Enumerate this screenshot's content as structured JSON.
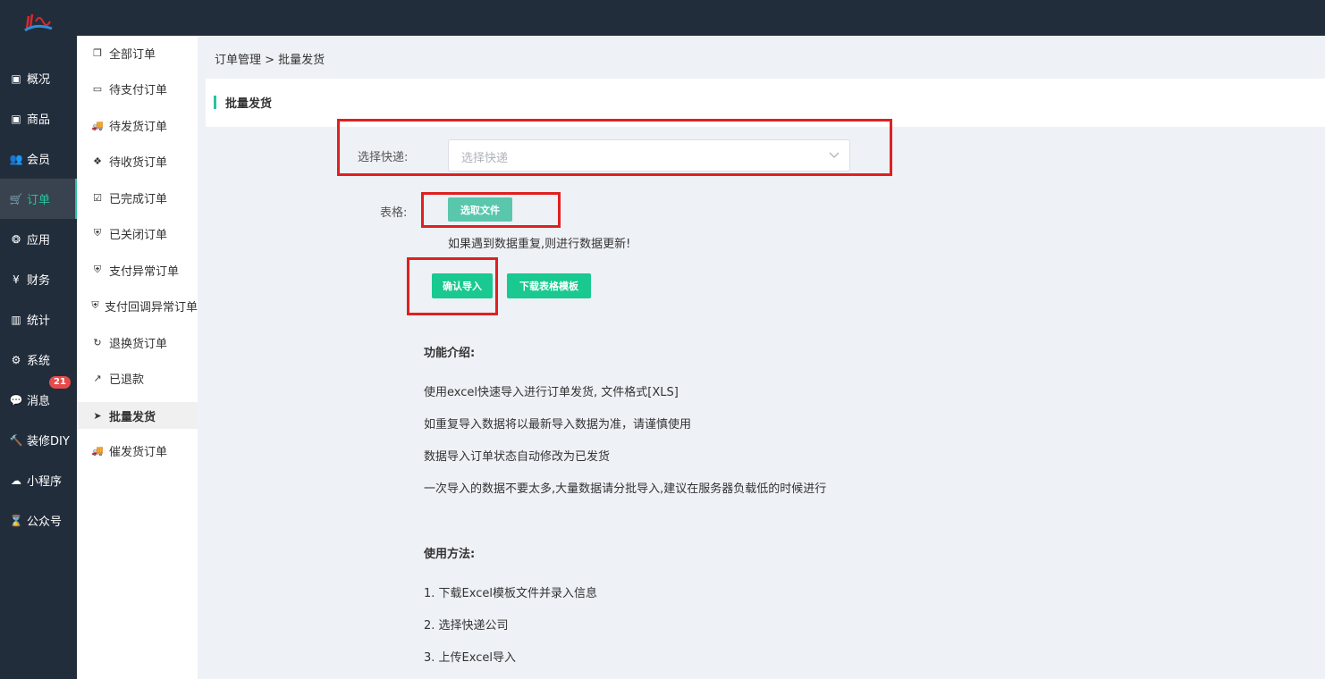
{
  "sidebar": {
    "items": [
      {
        "label": "概况",
        "icon": "dashboard-icon",
        "glyph": "▣"
      },
      {
        "label": "商品",
        "icon": "goods-icon",
        "glyph": "▣"
      },
      {
        "label": "会员",
        "icon": "users-icon",
        "glyph": "👥"
      },
      {
        "label": "订单",
        "icon": "cart-icon",
        "glyph": "🛒"
      },
      {
        "label": "应用",
        "icon": "apps-icon",
        "glyph": "❂"
      },
      {
        "label": "财务",
        "icon": "yen-icon",
        "glyph": "¥"
      },
      {
        "label": "统计",
        "icon": "chart-icon",
        "glyph": "▥"
      },
      {
        "label": "系统",
        "icon": "gears-icon",
        "glyph": "⚙"
      },
      {
        "label": "消息",
        "icon": "chat-icon",
        "glyph": "💬",
        "badge": "21"
      },
      {
        "label": "装修DIY",
        "icon": "hammer-icon",
        "glyph": "🔨"
      },
      {
        "label": "小程序",
        "icon": "wechat-icon",
        "glyph": "☁"
      },
      {
        "label": "公众号",
        "icon": "hourglass-icon",
        "glyph": "⌛"
      }
    ],
    "active_index": 3
  },
  "subnav": {
    "items": [
      {
        "label": "全部订单",
        "icon": "copy-icon",
        "glyph": "❐"
      },
      {
        "label": "待支付订单",
        "icon": "credit-card-icon",
        "glyph": "▭"
      },
      {
        "label": "待发货订单",
        "icon": "truck-icon",
        "glyph": "🚚"
      },
      {
        "label": "待收货订单",
        "icon": "dropbox-icon",
        "glyph": "❖"
      },
      {
        "label": "已完成订单",
        "icon": "check-square-icon",
        "glyph": "☑"
      },
      {
        "label": "已关闭订单",
        "icon": "shield-icon",
        "glyph": "⛨"
      },
      {
        "label": "支付异常订单",
        "icon": "shield-icon",
        "glyph": "⛨"
      },
      {
        "label": "支付回调异常订单",
        "icon": "shield-icon",
        "glyph": "⛨"
      },
      {
        "label": "退换货订单",
        "icon": "refresh-icon",
        "glyph": "↻"
      },
      {
        "label": "已退款",
        "icon": "share-icon",
        "glyph": "↗"
      },
      {
        "label": "批量发货",
        "icon": "send-icon",
        "glyph": "➤"
      },
      {
        "label": "催发货订单",
        "icon": "truck-icon",
        "glyph": "🚚"
      }
    ],
    "active_index": 10
  },
  "breadcrumb": "订单管理 > 批量发货",
  "panel": {
    "title": "批量发货"
  },
  "form": {
    "express_label": "选择快递:",
    "express_placeholder": "选择快递",
    "table_label": "表格:",
    "choose_file": "选取文件",
    "hint": "如果遇到数据重复,则进行数据更新!",
    "confirm": "确认导入",
    "download_template": "下载表格模板"
  },
  "intro": {
    "title": "功能介绍:",
    "lines": [
      "使用excel快速导入进行订单发货, 文件格式[XLS]",
      "如重复导入数据将以最新导入数据为准，请谨慎使用",
      "数据导入订单状态自动修改为已发货",
      "一次导入的数据不要太多,大量数据请分批导入,建议在服务器负载低的时候进行"
    ]
  },
  "usage": {
    "title": "使用方法:",
    "lines": [
      "1. 下载Excel模板文件并录入信息",
      "2. 选择快递公司",
      "3. 上传Excel导入"
    ]
  },
  "colors": {
    "sidebar_bg": "#222d3c",
    "accent": "#28c3a0",
    "button": "#19c98f",
    "highlight_box": "#e02020",
    "badge": "#e64a4a"
  }
}
